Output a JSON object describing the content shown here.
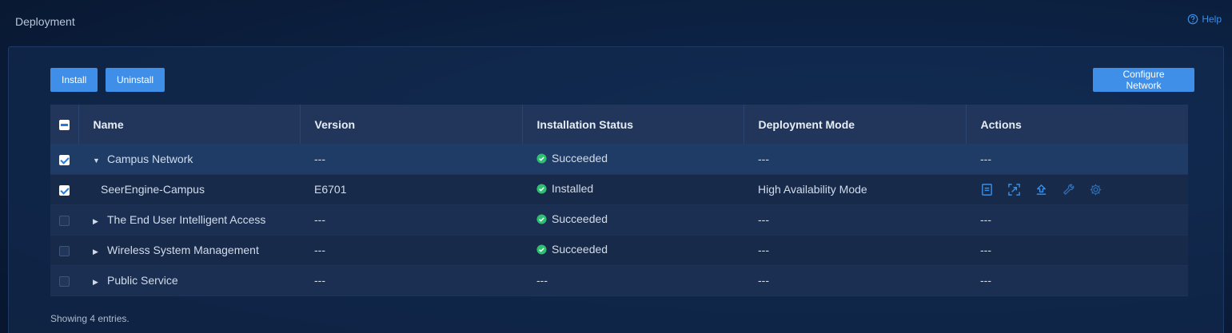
{
  "page": {
    "title": "Deployment",
    "help": "Help"
  },
  "toolbar": {
    "install": "Install",
    "uninstall": "Uninstall",
    "configure": "Configure Network"
  },
  "columns": {
    "name": "Name",
    "version": "Version",
    "status": "Installation Status",
    "mode": "Deployment Mode",
    "actions": "Actions"
  },
  "rows": [
    {
      "name": "Campus Network",
      "version": "---",
      "status": "Succeeded",
      "mode": "---",
      "actions": "---",
      "checked": true,
      "expanded": true
    },
    {
      "name": "SeerEngine-Campus",
      "version": "E6701",
      "status": "Installed",
      "mode": "High Availability Mode",
      "checked": true
    },
    {
      "name": "The End User Intelligent Access",
      "version": "---",
      "status": "Succeeded",
      "mode": "---",
      "actions": "---",
      "checked": false,
      "expanded": false
    },
    {
      "name": "Wireless System Management",
      "version": "---",
      "status": "Succeeded",
      "mode": "---",
      "actions": "---",
      "checked": false,
      "expanded": false
    },
    {
      "name": "Public Service",
      "version": "---",
      "status": "---",
      "mode": "---",
      "actions": "---",
      "checked": false,
      "expanded": false
    }
  ],
  "row_actions_icons": [
    "details-icon",
    "scale-icon",
    "upgrade-icon",
    "wrench-icon",
    "gear-icon"
  ],
  "footer": {
    "entries": "Showing 4 entries."
  },
  "colors": {
    "accent": "#3f8fe8",
    "success": "#2fbf71",
    "icon": "#3a8ee6"
  }
}
